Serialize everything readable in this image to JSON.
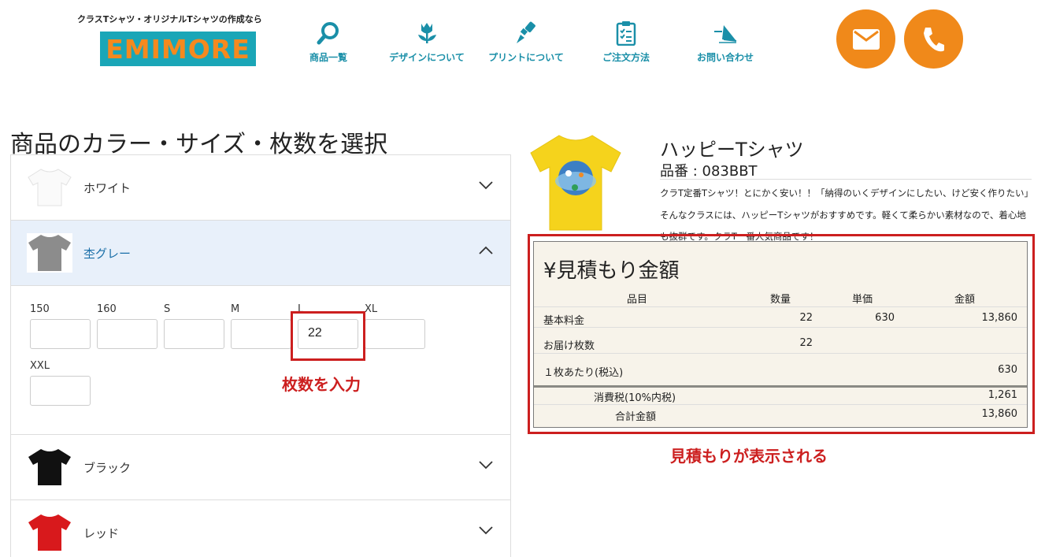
{
  "header": {
    "tagline": "クラスTシャツ・オリジナルTシャツの作成なら",
    "logo_text": "EMIMORE",
    "nav": [
      {
        "label": "商品一覧",
        "icon": "search-icon"
      },
      {
        "label": "デザインについて",
        "icon": "tulip-icon"
      },
      {
        "label": "プリントについて",
        "icon": "brush-icon"
      },
      {
        "label": "ご注文方法",
        "icon": "clipboard-icon"
      },
      {
        "label": "お問い合わせ",
        "icon": "paper-plane-icon"
      }
    ],
    "mail_icon": "mail-icon",
    "phone_icon": "phone-icon",
    "accent_color": "#f0891a",
    "brand_color": "#1aa6b7"
  },
  "selection": {
    "title": "商品のカラー・サイズ・枚数を選択",
    "colors": [
      {
        "label": "ホワイト",
        "swatch": "#ffffff",
        "expanded": false
      },
      {
        "label": "杢グレー",
        "swatch": "#8a8a8a",
        "expanded": true
      },
      {
        "label": "ブラック",
        "swatch": "#111111",
        "expanded": false
      },
      {
        "label": "レッド",
        "swatch": "#d8191c",
        "expanded": false
      }
    ],
    "sizes": [
      {
        "label": "150",
        "value": ""
      },
      {
        "label": "160",
        "value": ""
      },
      {
        "label": "S",
        "value": ""
      },
      {
        "label": "M",
        "value": ""
      },
      {
        "label": "L",
        "value": "22"
      },
      {
        "label": "XL",
        "value": ""
      },
      {
        "label": "XXL",
        "value": ""
      }
    ],
    "annotation": "枚数を入力"
  },
  "product": {
    "name": "ハッピーTシャツ",
    "code": "品番 : 083BBT",
    "description": "クラT定番Tシャツ！とにかく安い！！「納得のいくデザインにしたい、けど安く作りたい」そんなクラスには、ハッピーTシャツがおすすめです。軽くて柔らかい素材なので、着心地も抜群です。クラT一番人気商品です！",
    "image_color": "#f5d31c"
  },
  "estimate": {
    "title": "¥見積もり金額",
    "headers": {
      "item": "品目",
      "qty": "数量",
      "unit": "単価",
      "amount": "金額"
    },
    "base": {
      "item": "基本料金",
      "qty": "22",
      "unit": "630",
      "amount": "13,860"
    },
    "delivery": {
      "item": "お届け枚数",
      "qty": "22"
    },
    "per_piece": {
      "item": "１枚あたり(税込)",
      "amount": "630"
    },
    "tax": {
      "item": "消費税(10%内税)",
      "amount": "1,261"
    },
    "total": {
      "item": "合計金額",
      "amount": "13,860"
    },
    "annotation": "見積もりが表示される"
  }
}
